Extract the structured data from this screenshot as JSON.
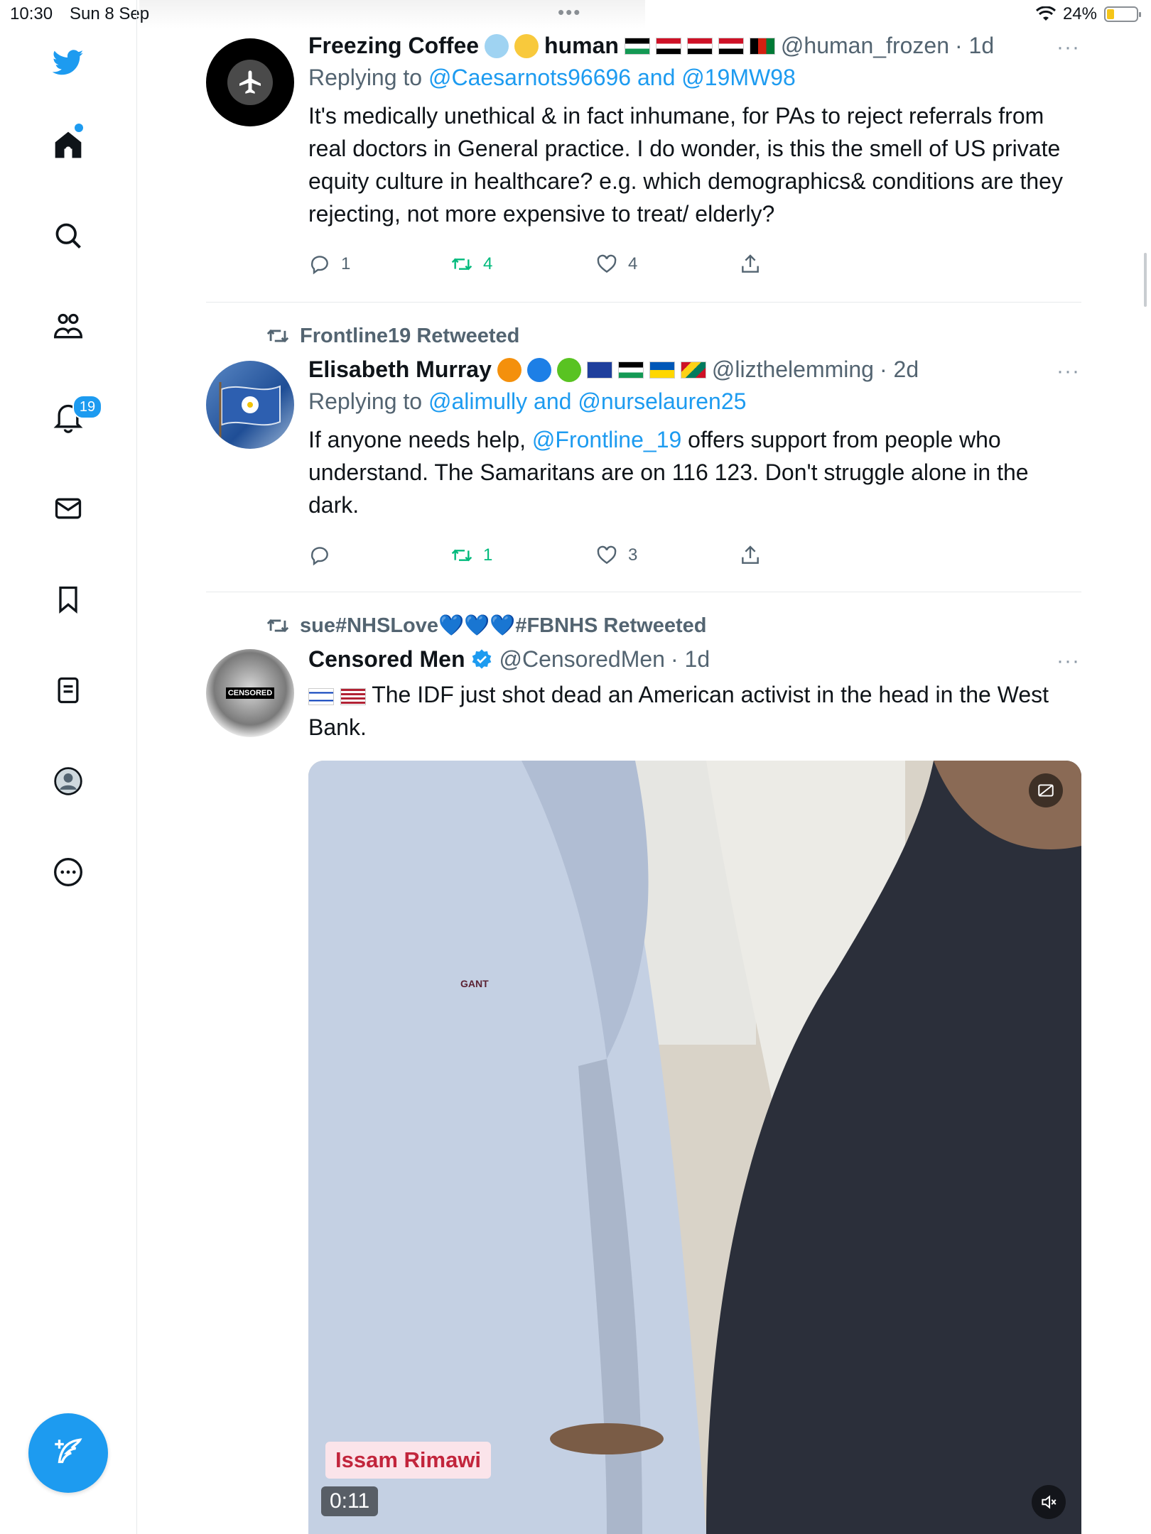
{
  "status_bar": {
    "time": "10:30",
    "date": "Sun 8 Sep",
    "battery": "24%",
    "battery_level": 0.24
  },
  "sidebar": {
    "items": [
      "twitter-logo",
      "home-icon",
      "search-icon",
      "communities-icon",
      "bell-icon",
      "mail-icon",
      "bookmark-icon",
      "lists-icon",
      "profile-icon",
      "more-icon"
    ],
    "notifications_badge": "19"
  },
  "tweets": [
    {
      "name": "Freezing Coffee",
      "name_suffix": "human",
      "handle": "@human_frozen",
      "time": "· 1d",
      "more": "···",
      "replying_prefix": "Replying to",
      "replying_to": "@Caesarnots96696 and @19MW98",
      "text": "It's medically unethical & in fact inhumane, for PAs to reject referrals from real doctors in General practice. I do wonder, is this the smell of US private equity culture in healthcare? e.g. which demographics& conditions are they rejecting, not more expensive to treat/ elderly?",
      "replies": "1",
      "retweets": "4",
      "likes": "4"
    },
    {
      "retweeted_by": "Frontline19 Retweeted",
      "name": "Elisabeth Murray",
      "handle": "@lizthelemming",
      "time": "· 2d",
      "more": "···",
      "replying_prefix": "Replying to",
      "replying_to": "@alimully and @nurselauren25",
      "text_pre": "If anyone needs help, ",
      "text_mention": "@Frontline_19",
      "text_post": " offers support from people who understand. The Samaritans are on 116 123. Don't struggle alone in the dark.",
      "replies": "",
      "retweets": "1",
      "likes": "3"
    },
    {
      "retweeted_by": "sue#NHSLove💙💙💙#FBNHS Retweeted",
      "name": "Censored Men",
      "handle": "@CensoredMen",
      "time": "· 1d",
      "more": "···",
      "avatar_label": "CENSORED",
      "text": "The IDF just shot dead an American activist in the head in the West Bank.",
      "video": {
        "caption": "Issam Rimawi",
        "duration": "0:11",
        "logo": "GANT"
      }
    }
  ]
}
